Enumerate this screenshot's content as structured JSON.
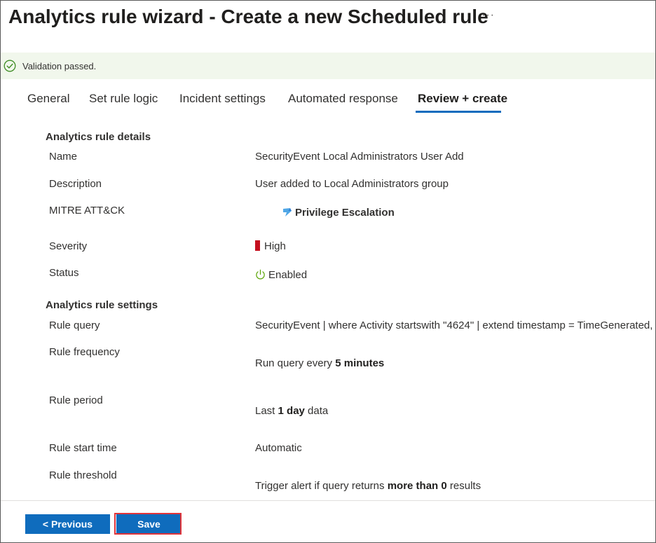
{
  "header": {
    "title": "Analytics rule wizard - Create a new Scheduled rule",
    "more_label": "···"
  },
  "banner": {
    "icon": "success-check-icon",
    "message": "Validation passed.",
    "color": "#f1f7ec"
  },
  "tabs": [
    {
      "label": "General"
    },
    {
      "label": "Set rule logic"
    },
    {
      "label": "Incident settings"
    },
    {
      "label": "Automated response"
    },
    {
      "label": "Review + create",
      "active": true
    }
  ],
  "details": {
    "heading": "Analytics rule details",
    "name_label": "Name",
    "name_value": "SecurityEvent Local Administrators User Add",
    "description_label": "Description",
    "description_value": "User added to Local Administrators group",
    "mitre_label": "MITRE ATT&CK",
    "mitre_value": "Privilege Escalation",
    "severity_label": "Severity",
    "severity_value": "High",
    "severity_color": "#c50f1f",
    "status_label": "Status",
    "status_value": "Enabled"
  },
  "settings": {
    "heading": "Analytics rule settings",
    "query_label": "Rule query",
    "query_value": "SecurityEvent | where Activity startswith \"4624\" | extend timestamp = TimeGenerated,",
    "frequency_label": "Rule frequency",
    "frequency_prefix": "Run query every ",
    "frequency_bold": "5 minutes",
    "period_label": "Rule period",
    "period_prefix": "Last ",
    "period_bold": "1 day",
    "period_suffix": " data",
    "start_label": "Rule start time",
    "start_value": "Automatic",
    "threshold_label": "Rule threshold",
    "threshold_prefix": "Trigger alert if query returns ",
    "threshold_bold": "more than 0",
    "threshold_suffix": " results"
  },
  "footer": {
    "previous_label": "< Previous",
    "save_label": "Save",
    "accent_color": "#0f6cbd"
  }
}
